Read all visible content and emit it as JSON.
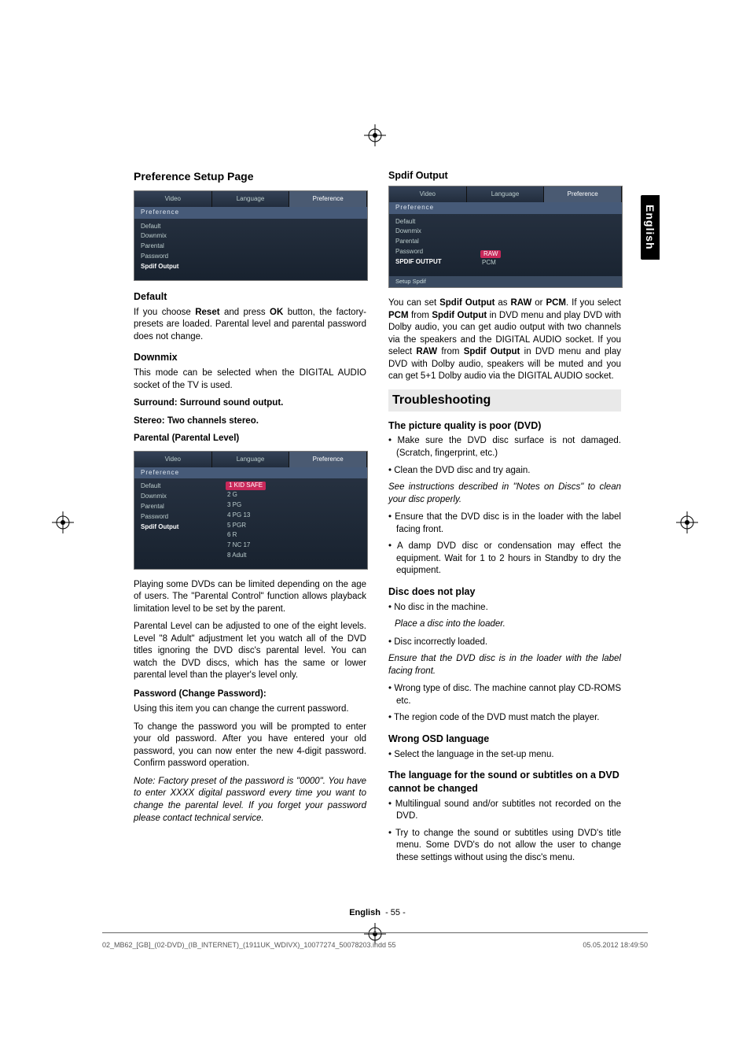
{
  "sidetab": "English",
  "left": {
    "h_pref_setup": "Preference Setup Page",
    "osd1": {
      "tabs": [
        "Video",
        "Language",
        "Preference"
      ],
      "band": "Preference",
      "items": [
        "Default",
        "Downmix",
        "Parental",
        "Password",
        "Spdif Output"
      ]
    },
    "h_default": "Default",
    "p_default": "If you choose Reset and press OK button, the factory-presets are loaded. Parental level and parental password does not change.",
    "h_downmix": "Downmix",
    "p_downmix": "This mode can be selected when the DIGITAL AUDIO socket of the TV is used.",
    "b_surround": "Surround: Surround sound output.",
    "b_stereo": "Stereo: Two channels stereo.",
    "b_parental": "Parental (Parental Level)",
    "osd2": {
      "tabs": [
        "Video",
        "Language",
        "Preference"
      ],
      "band": "Preference",
      "items": [
        "Default",
        "Downmix",
        "Parental",
        "Password",
        "Spdif Output"
      ],
      "levels": [
        "1  KID SAFE",
        "2  G",
        "3  PG",
        "4  PG  13",
        "5  PGR",
        "6  R",
        "7  NC  17",
        "8  Adult"
      ]
    },
    "p_parental1": "Playing some DVDs can be limited depending on the age of users. The \"Parental Control\" function allows playback limitation level to be set by the parent.",
    "p_parental2": "Parental Level can be adjusted to one of the eight levels. Level \"8 Adult\" adjustment let you watch all of the DVD titles ignoring the DVD disc's parental level. You can watch the DVD discs, which has the same or lower parental level than the player's level only.",
    "h_password": "Password (Change Password):",
    "p_password1": "Using this item you can change the current password.",
    "p_password2": "To change the password you will be prompted to enter your old password. After you have entered your old password, you can now enter the new 4-digit password. Confirm password operation.",
    "p_password_note": "Note: Factory preset of the password is \"0000\". You have to enter XXXX digital password every time you want to change the parental level. If you forget your password please contact technical service."
  },
  "right": {
    "h_spdif": "Spdif Output",
    "osd3": {
      "tabs": [
        "Video",
        "Language",
        "Preference"
      ],
      "band": "Preference",
      "items": [
        "Default",
        "Downmix",
        "Parental",
        "Password",
        "SPDIF OUTPUT"
      ],
      "opts": [
        "RAW",
        "PCM"
      ],
      "foot": "Setup Spdif"
    },
    "p_spdif": "You can set Spdif Output as RAW or PCM. If you select PCM from Spdif Output in DVD menu and play DVD with Dolby audio, you can get audio output with two channels via the speakers and the DIGITAL AUDIO socket. If you select RAW from Spdif Output in DVD menu and play DVD with Dolby audio, speakers will be muted and you can get 5+1 Dolby audio via the DIGITAL AUDIO socket.",
    "h_trouble": "Troubleshooting",
    "h_poor": "The picture quality is poor (DVD)",
    "poor_items": [
      "Make sure the DVD disc surface is not damaged. (Scratch, fingerprint, etc.)",
      "Clean the DVD disc and try again."
    ],
    "poor_note": "See instructions described in \"Notes on Discs\" to clean your disc properly.",
    "poor_items2": [
      "Ensure that the DVD disc is in the loader with the label facing front.",
      "A damp DVD disc or condensation may effect the equipment. Wait for 1 to 2 hours in Standby to dry the equipment."
    ],
    "h_noplay": "Disc does not play",
    "noplay1": "No disc in the machine.",
    "noplay1_note": "Place a disc into the loader.",
    "noplay2": "Disc incorrectly loaded.",
    "noplay2_note": "Ensure that the DVD disc is in the loader with the label facing front.",
    "noplay_items": [
      "Wrong type of disc. The machine cannot play CD-ROMS etc.",
      "The region code of the DVD must match the player."
    ],
    "h_wrongosd": "Wrong OSD language",
    "wrongosd_item": "Select the language in the set-up menu.",
    "h_lang": "The language for the sound or subtitles on a DVD cannot be changed",
    "lang_items": [
      "Multilingual sound and/or subtitles not recorded on the DVD.",
      "Try to change the sound or subtitles using DVD's title menu. Some DVD's do not allow the user to change these settings without using the disc's menu."
    ]
  },
  "footer": {
    "lang": "English",
    "page": "- 55 -"
  },
  "print": {
    "left": "02_MB62_[GB]_(02-DVD)_(IB_INTERNET)_(1911UK_WDIVX)_10077274_50078203.indd   55",
    "right": "05.05.2012   18:49:50"
  }
}
